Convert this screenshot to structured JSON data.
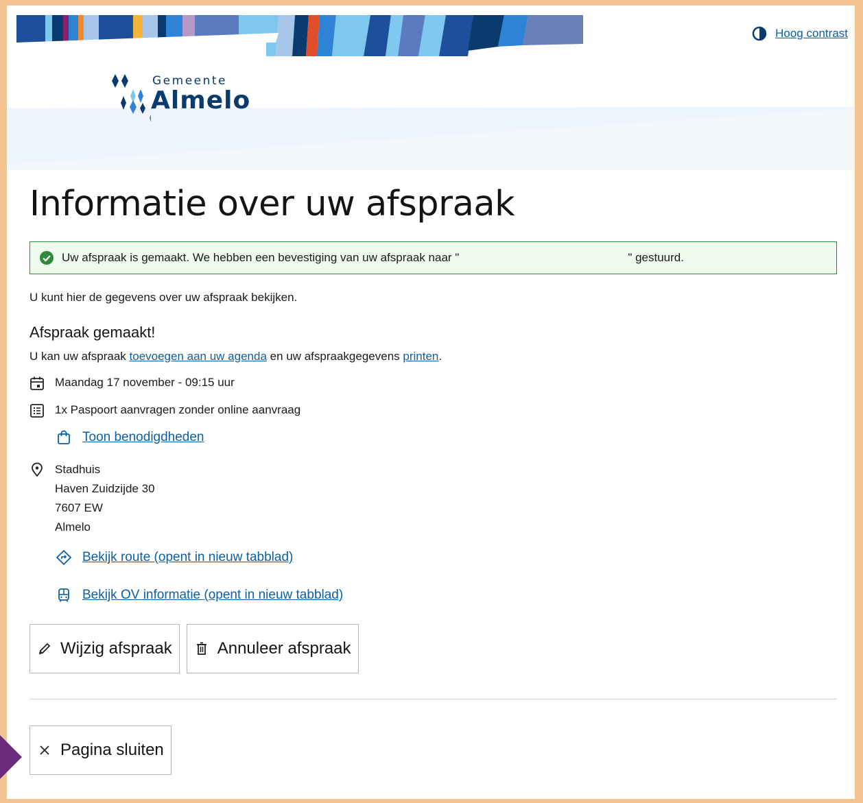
{
  "header": {
    "contrast_label": "Hoog contrast",
    "logo_small": "Gemeente",
    "logo_big": "Almelo"
  },
  "main": {
    "title": "Informatie over uw afspraak",
    "alert": {
      "prefix": "Uw afspraak is gemaakt. We hebben een bevestiging van uw afspraak naar \"",
      "suffix": "\" gestuurd."
    },
    "intro": "U kunt hier de gegevens over uw afspraak bekijken.",
    "subtitle": "Afspraak gemaakt!",
    "agenda_line": {
      "part1": "U kan uw afspraak ",
      "link1": "toevoegen aan uw agenda",
      "part2": " en uw afspraakgegevens ",
      "link2": "printen",
      "part3": "."
    },
    "datetime": "Maandag 17 november - 09:15 uur",
    "product": "1x Paspoort aanvragen zonder online aanvraag",
    "requirements_link": "Toon benodigdheden",
    "address": {
      "name": "Stadhuis",
      "street": "Haven Zuidzijde 30",
      "postcode": "7607 EW",
      "city": "Almelo"
    },
    "route_link": "Bekijk route (opent in nieuw tabblad)",
    "ov_link": "Bekijk OV informatie (opent in nieuw tabblad)",
    "edit_button": "Wijzig afspraak",
    "cancel_button": "Annuleer afspraak",
    "close_button": "Pagina sluiten"
  },
  "colors": {
    "page_border": "#f5c48e",
    "link": "#0b5fa5",
    "success": "#2e8b3a",
    "logo": "#0a3b6e"
  }
}
